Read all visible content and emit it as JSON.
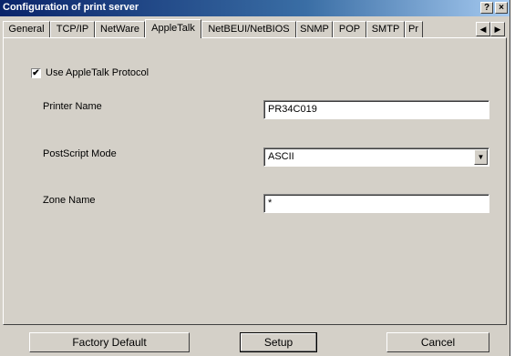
{
  "window": {
    "title": "Configuration of print server",
    "help_btn": "?",
    "close_btn": "×"
  },
  "tabs": [
    {
      "label": "General",
      "active": false
    },
    {
      "label": "TCP/IP",
      "active": false
    },
    {
      "label": "NetWare",
      "active": false
    },
    {
      "label": "AppleTalk",
      "active": true
    },
    {
      "label": "NetBEUI/NetBIOS",
      "active": false
    },
    {
      "label": "SNMP",
      "active": false
    },
    {
      "label": "POP",
      "active": false
    },
    {
      "label": "SMTP",
      "active": false
    },
    {
      "label": "Pr",
      "active": false
    }
  ],
  "tab_scroll": {
    "left": "◀",
    "right": "▶"
  },
  "form": {
    "use_appletalk": {
      "label": "Use AppleTalk Protocol",
      "checked": true,
      "mark": "✔"
    },
    "printer_name": {
      "label": "Printer Name",
      "value": "PR34C019"
    },
    "postscript_mode": {
      "label": "PostScript Mode",
      "value": "ASCII",
      "arrow": "▼"
    },
    "zone_name": {
      "label": "Zone Name",
      "value": "*"
    }
  },
  "buttons": {
    "factory_default": "Factory Default",
    "setup": "Setup",
    "cancel": "Cancel"
  }
}
